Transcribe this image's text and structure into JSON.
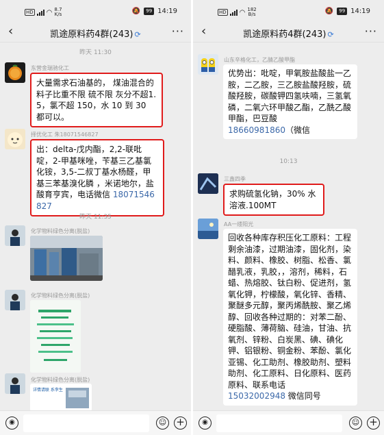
{
  "status": {
    "left": {
      "speed_value": "8.7",
      "speed_unit": "K/s"
    },
    "right": {
      "speed_value": "182",
      "speed_unit": "B/s"
    },
    "battery": "99",
    "time": "14:19"
  },
  "header": {
    "title": "凯途原料药4群(243)"
  },
  "left": {
    "time_1": "昨天 11:30",
    "msg1": {
      "sender": "东营金瑞驰化工",
      "text": "大量需求石油基的， 煤油混合的料子比重不限 硫不限 灰分不超1.5，氯不超 150，水 10 到 30 都可以。"
    },
    "msg2": {
      "sender": "择优化工 朱18071546827",
      "text": "出：delta-戊内酯，2,2-联吡啶，2-甲基咪唑，苄基三乙基氯化铵，3,5-二叔丁基水杨醛，甲基三苯基溴化膦 ，米诺地尔，盐酸育亨宾，电话微信 ",
      "phone": "18071546827"
    },
    "time_2": "昨天 11:35",
    "msg3": {
      "sender": "化学物料绿色分离(脱盐)"
    },
    "msg4": {
      "sender": "化学物料绿色分离(脱盐)"
    },
    "msg5": {
      "sender": "化学物料绿色分离(脱盐)",
      "image_caption": "详情请联 系李生"
    }
  },
  "right": {
    "msg1": {
      "sender": "山东辛格化工，乙腈乙酸甲酯",
      "text": "优势出：吡啶，甲氧胺盐酸盐一乙胺，二乙胺，三乙胺盐酸羟胺，硫酸羟胺，碳酸钾四氢呋喃，三氢氧磷，二氧六环甲酸乙酯，乙酰乙酸甲酯，巴豆酸",
      "phone": "18660981860",
      "suffix": "（微信"
    },
    "time_1": "10:13",
    "msg2": {
      "sender": "三鑫四季",
      "text": "求购硫氢化钠，30% 水溶液.100MT"
    },
    "msg3": {
      "sender": "AA一缕阳光",
      "text": "回收各种库存积压化工原料：工程剩余油漆，过期油漆，固化剂，染料、颜料、橡胶、树脂、松香、氯醋乳液，乳胶，，溶剂，稀料，石蜡、热熔胶、钛白粉、促进剂，氢氧化钾，柠檬酸，氧化锌、香精、聚醚多元醇，聚丙烯酰胺、聚乙烯醇、回收各种过期的：对苯二酚、硬脂酸、薄荷脑、硅油，甘油、抗氧剂、锌粉、白炭黑、碘、碘化钾、铝银粉、铜金粉、苯酚、氯化亚锡、化工助剂、橡胶助剂、塑料助剂、化工原料、日化原料、医药原料、联系电话",
      "phone": "15032002948",
      "suffix": " 微信同号"
    }
  },
  "icons": {
    "back": "‹",
    "more": "···",
    "voice": "◉",
    "emoji": "☺",
    "plus": "+",
    "link": "⟳"
  },
  "colors": {
    "highlight": "#e01a1a",
    "link": "#3a67a8",
    "bg": "#ededed"
  }
}
